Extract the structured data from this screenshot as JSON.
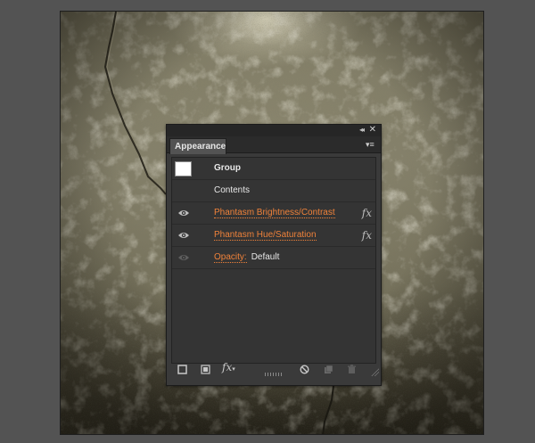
{
  "panel": {
    "tab_label": "Appearance",
    "collapse_glyph": "◂◂",
    "close_glyph": "✕",
    "menu_glyph": "▾≡"
  },
  "rows": {
    "group_label": "Group",
    "contents_label": "Contents",
    "effect1_label": "Phantasm Brightness/Contrast",
    "effect1_fx": "fx",
    "effect2_label": "Phantasm Hue/Saturation",
    "effect2_fx": "fx",
    "opacity_label": "Opacity:",
    "opacity_value": "Default"
  },
  "toolbar": {
    "fx_label": "fx"
  },
  "colors": {
    "accent": "#f0823a",
    "panel_bg": "#3a3a3a",
    "workspace_bg": "#535353"
  }
}
